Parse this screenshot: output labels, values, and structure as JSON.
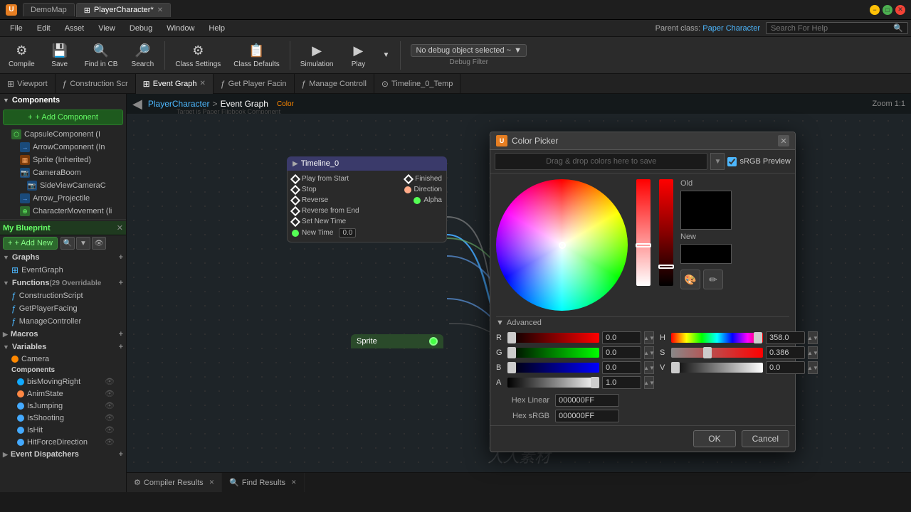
{
  "titlebar": {
    "app_name": "DemoMap",
    "tab1_label": "PlayerCharacter*",
    "minimize": "−",
    "maximize": "□",
    "close": "✕"
  },
  "menubar": {
    "items": [
      "File",
      "Edit",
      "Asset",
      "View",
      "Debug",
      "Window",
      "Help"
    ],
    "parent_class_label": "Parent class:",
    "parent_class_value": "Paper Character",
    "search_placeholder": "Search For Help"
  },
  "toolbar": {
    "compile": "Compile",
    "save": "Save",
    "find_in_cb": "Find in CB",
    "search": "Search",
    "class_settings": "Class Settings",
    "class_defaults": "Class Defaults",
    "simulation": "Simulation",
    "play": "Play",
    "debug_object": "No debug object selected ~",
    "debug_filter": "Debug Filter"
  },
  "tabs": [
    {
      "label": "Viewport",
      "icon": "⊞",
      "active": false
    },
    {
      "label": "Construction Scr",
      "icon": "ƒ",
      "active": false
    },
    {
      "label": "Event Graph",
      "icon": "⊞",
      "active": true,
      "closeable": true
    },
    {
      "label": "Get Player Facin",
      "icon": "ƒ",
      "active": false
    },
    {
      "label": "Manage Controll",
      "icon": "ƒ",
      "active": false
    },
    {
      "label": "Timeline_0_Temp",
      "icon": "⊙",
      "active": false
    }
  ],
  "graph_header": {
    "player_character": "PlayerCharacter",
    "separator": ">",
    "event_graph": "Event Graph",
    "zoom": "Zoom 1:1",
    "color_label": "Color",
    "target_label": "Target is Paper Flipbook Component"
  },
  "left_panel": {
    "components_section": "Components",
    "add_component": "+ Add Component",
    "items": [
      {
        "name": "CapsuleComponent (I",
        "type": "capsule"
      },
      {
        "name": "ArrowComponent (In",
        "type": "arrow"
      },
      {
        "name": "Sprite (Inherited)",
        "type": "sprite"
      },
      {
        "name": "CameraBoom",
        "type": "camera"
      },
      {
        "name": "SideViewCameraC",
        "type": "camera"
      },
      {
        "name": "Arrow_Projectile",
        "type": "arrow"
      },
      {
        "name": "CharacterMovement (li",
        "type": "movement"
      }
    ],
    "my_blueprint": "My Blueprint",
    "add_new": "+ Add New",
    "graphs_section": "Graphs",
    "graphs_add": "+",
    "event_graph": "EventGraph",
    "functions_section": "Functions",
    "functions_count": "(29 Overridable",
    "functions_add": "+",
    "functions": [
      "ConstructionScript",
      "GetPlayerFacing",
      "ManageController"
    ],
    "macros_section": "Macros",
    "macros_add": "+",
    "variables_section": "Variables",
    "variables_add": "+",
    "camera_var": "Camera",
    "components_var": "Components",
    "vars": [
      "bisMovingRight",
      "AnimState",
      "IsJumping",
      "IsShooting",
      "IsHit",
      "HitForceDirection"
    ],
    "event_dispatchers_section": "Event Dispatchers",
    "event_dispatchers_add": "+"
  },
  "nodes": {
    "timeline": {
      "header": "Timeline_0",
      "pins_out": [
        "Play from Start",
        "Finished",
        "Stop",
        "Direction",
        "Reverse",
        "Alpha",
        "Reverse from End",
        "Set New Time",
        "New Time"
      ]
    },
    "sprite": {
      "header": "Sprite",
      "pin": "●"
    }
  },
  "bottom_tabs": [
    {
      "label": "Compiler Results",
      "icon": "⚙",
      "closeable": true
    },
    {
      "label": "Find Results",
      "icon": "🔍",
      "closeable": true
    }
  ],
  "color_picker": {
    "title": "Color Picker",
    "save_area_label": "Drag & drop colors here to save",
    "srgb_preview": "sRGB Preview",
    "old_label": "Old",
    "new_label": "New",
    "advanced_label": "Advanced",
    "r_label": "R",
    "r_value": "0.0",
    "g_label": "G",
    "g_value": "0.0",
    "b_label": "B",
    "b_value": "0.0",
    "a_label": "A",
    "a_value": "1.0",
    "h_label": "H",
    "h_value": "358.0",
    "s_label": "S",
    "s_value": "0.386",
    "v_label": "V",
    "v_value": "0.0",
    "hex_linear_label": "Hex Linear",
    "hex_linear_value": "000000FF",
    "hex_srgb_label": "Hex sRGB",
    "hex_srgb_value": "000000FF",
    "ok_label": "OK",
    "cancel_label": "Cancel"
  }
}
